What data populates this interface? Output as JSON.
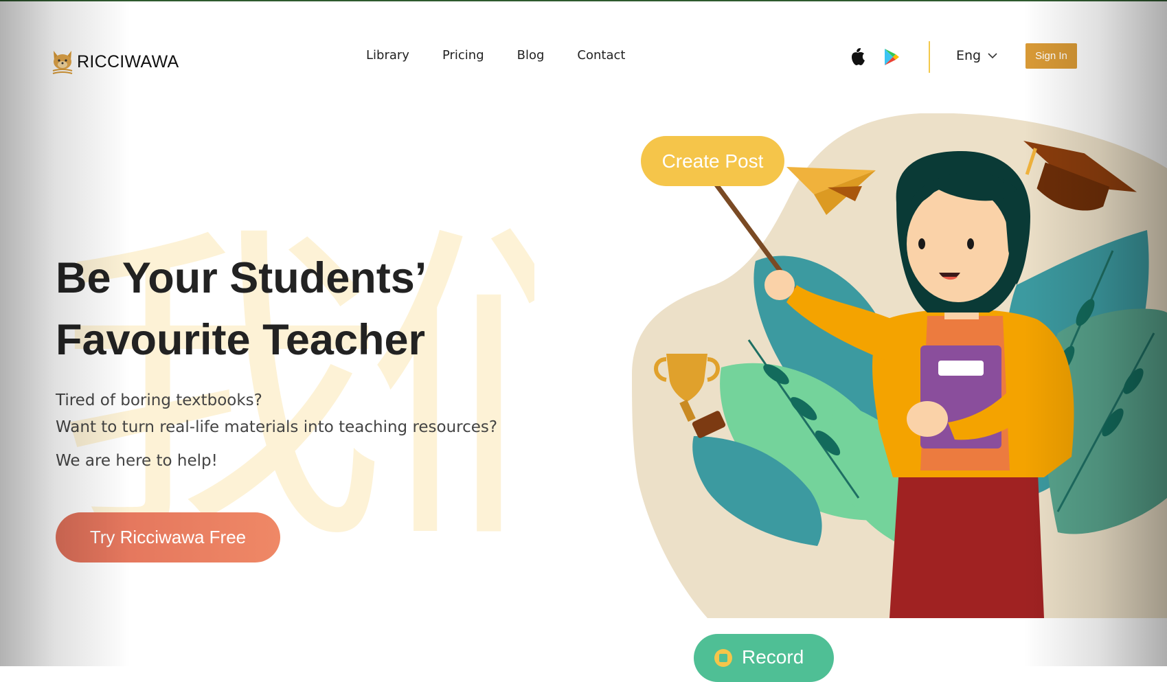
{
  "brand": {
    "name": "RICCIWAWA",
    "logo_icon": "fox-face-icon"
  },
  "nav": {
    "items": [
      {
        "label": "Library"
      },
      {
        "label": "Pricing"
      },
      {
        "label": "Blog"
      },
      {
        "label": "Contact"
      }
    ]
  },
  "header": {
    "app_store_icon": "apple-icon",
    "play_store_icon": "google-play-icon",
    "language": "Eng",
    "sign_in_label": "Sign In"
  },
  "hero": {
    "background_glyph": "我们",
    "title_line1": "Be Your Students’",
    "title_line2": "Favourite Teacher",
    "line1": "Tired of boring textbooks?",
    "line2": "Want to turn real-life materials into teaching resources?",
    "line3": "We are here to help!",
    "cta_label": "Try Ricciwawa Free"
  },
  "illustration": {
    "create_label": "Create Post",
    "record_label": "Record"
  },
  "colors": {
    "accent": "#d99a36",
    "cta": "#e8785e",
    "yellow": "#f5c54a",
    "green": "#4fbf95"
  }
}
